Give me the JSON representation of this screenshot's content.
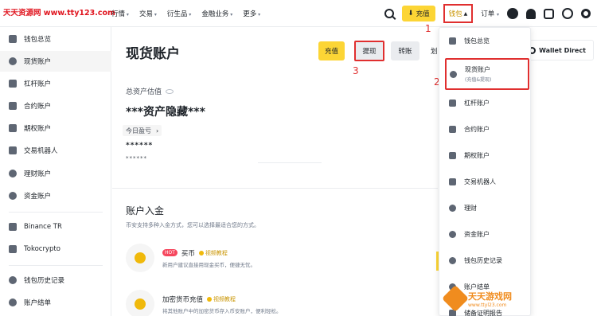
{
  "watermark": "天天资源网 www.tty123.com",
  "nav": {
    "menu": [
      "行情",
      "交易",
      "衍生品",
      "金融业务",
      "更多"
    ],
    "deposit_label": "充值",
    "wallet_label": "钱包",
    "orders_label": "订单"
  },
  "sidebar": {
    "items": [
      {
        "label": "钱包总览"
      },
      {
        "label": "现货账户"
      },
      {
        "label": "杠杆账户"
      },
      {
        "label": "合约账户"
      },
      {
        "label": "期权账户"
      },
      {
        "label": "交易机器人"
      },
      {
        "label": "理财账户"
      },
      {
        "label": "资金账户"
      },
      {
        "label": "Binance TR"
      },
      {
        "label": "Tokocrypto"
      },
      {
        "label": "钱包历史记录"
      },
      {
        "label": "账户结单"
      }
    ]
  },
  "main": {
    "title": "现货账户",
    "buttons": {
      "deposit": "充值",
      "withdraw": "提现",
      "transfer": "转账",
      "partial": "划"
    },
    "wallet_direct": "Wallet Direct",
    "estimated_label": "总资产估值",
    "hidden_text": "***资产隐藏***",
    "pnl_label": "今日盈亏",
    "stars1": "******",
    "stars2": "******",
    "deposit_section": {
      "title": "账户入金",
      "subtitle": "币安支持多种入金方式，您可以选择最适合您的方式。",
      "cards": [
        {
          "hot": "HOT",
          "title": "买币",
          "tutorial": "视频教程",
          "desc": "新用户建议直接用现金买币，便捷无忧。"
        },
        {
          "title": "加密货币充值",
          "tutorial": "视频教程",
          "desc": "将其他账户中的加密货币存入币安账户，便利轻松。"
        }
      ]
    }
  },
  "annotations": {
    "n1": "1",
    "n2": "2",
    "n3": "3"
  },
  "dropdown": {
    "items": [
      {
        "label": "钱包总览"
      },
      {
        "label": "现货账户",
        "sub": "(充值&提现)"
      },
      {
        "label": "杠杆账户"
      },
      {
        "label": "合约账户"
      },
      {
        "label": "期权账户"
      },
      {
        "label": "交易机器人"
      },
      {
        "label": "理财"
      },
      {
        "label": "资金账户"
      },
      {
        "label": "钱包历史记录"
      },
      {
        "label": "账户结单"
      },
      {
        "label": "储备证明报告"
      }
    ]
  },
  "logo_watermark": {
    "title": "天天游戏网",
    "url": "www.ttyl23.com"
  },
  "colors": {
    "accent": "#fcd535",
    "highlight": "#e02f2f",
    "brand_text": "#c99400"
  }
}
